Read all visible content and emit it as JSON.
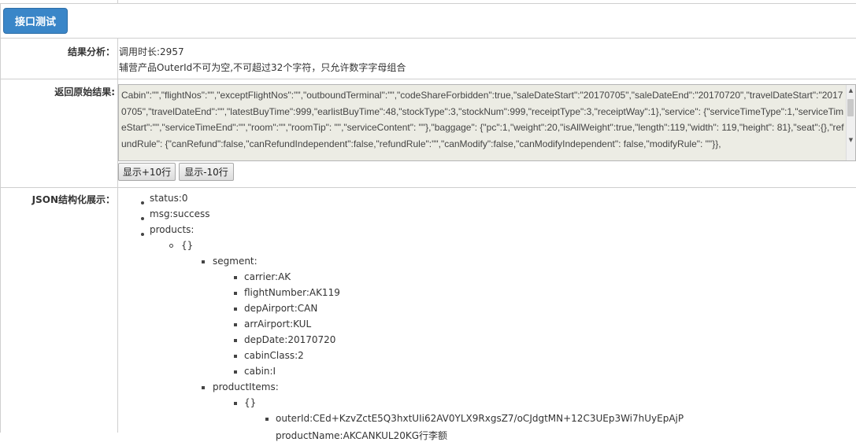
{
  "test_button": "接口测试",
  "result_analysis": {
    "label": "结果分析：",
    "duration": "调用时长:2957",
    "message": "辅营产品OuterId不可为空,不可超过32个字符，只允许数字字母组合"
  },
  "raw_result": {
    "label": "返回原始结果:",
    "text": "Cabin\":\"\",\"flightNos\":\"\",\"exceptFlightNos\":\"\",\"outboundTerminal\":\"\",\"codeShareForbidden\":true,\"saleDateStart\":\"20170705\",\"saleDateEnd\":\"20170720\",\"travelDateStart\":\"20170705\",\"travelDateEnd\":\"\",\"latestBuyTime\":999,\"earlistBuyTime\":48,\"stockType\":3,\"stockNum\":999,\"receiptType\":3,\"receiptWay\":1},\"service\": {\"serviceTimeType\":1,\"serviceTimeStart\":\"\",\"serviceTimeEnd\":\"\",\"room\":\"\",\"roomTip\": \"\",\"serviceContent\": \"\"},\"baggage\": {\"pc\":1,\"weight\":20,\"isAllWeight\":true,\"length\":119,\"width\": 119,\"height\": 81},\"seat\":{},\"refundRule\": {\"canRefund\":false,\"canRefundIndependent\":false,\"refundRule\":\"\",\"canModify\":false,\"canModifyIndependent\": false,\"modifyRule\": \"\"}},",
    "show_more": "显示+10行",
    "show_less": "显示-10行"
  },
  "json_tree": {
    "label": "JSON结构化展示：",
    "status": "status:0",
    "msg": "msg:success",
    "products": "products:",
    "product_obj": "{}",
    "segment": "segment:",
    "carrier": "carrier:AK",
    "flightNumber": "flightNumber:AK119",
    "depAirport": "depAirport:CAN",
    "arrAirport": "arrAirport:KUL",
    "depDate": "depDate:20170720",
    "cabinClass": "cabinClass:2",
    "cabin": "cabin:I",
    "productItems": "productItems:",
    "item_obj": "{}",
    "outerId": "outerId:CEd+KzvZctE5Q3hxtUIi62AV0YLX9RxgsZ7/oCJdgtMN+12C3UEp3Wi7hUyEpAjP",
    "next_partial": "productName:AKCANKUL20KG行李额"
  },
  "colors": {
    "primary": "#3a86c8",
    "border": "#cfcfcf",
    "raw_bg": "#ecece4"
  }
}
